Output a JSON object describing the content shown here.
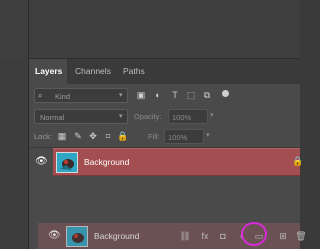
{
  "panel": {
    "tabs": [
      {
        "label": "Layers"
      },
      {
        "label": "Channels"
      },
      {
        "label": "Paths"
      }
    ],
    "filter": {
      "label": "Kind"
    },
    "blend_mode": {
      "label": "Normal"
    },
    "opacity": {
      "label": "Opacity:",
      "value": "100%"
    },
    "lock": {
      "label": "Lock:"
    },
    "fill": {
      "label": "Fill:",
      "value": "100%"
    }
  },
  "layers": [
    {
      "name": "Background",
      "visible": true,
      "locked": true
    }
  ],
  "drag_ghost": {
    "name": "Background"
  },
  "colors": {
    "selected_layer": "#a34e50",
    "highlight_circle": "#d62bd6",
    "thumbnail": "#2fa6c3"
  }
}
